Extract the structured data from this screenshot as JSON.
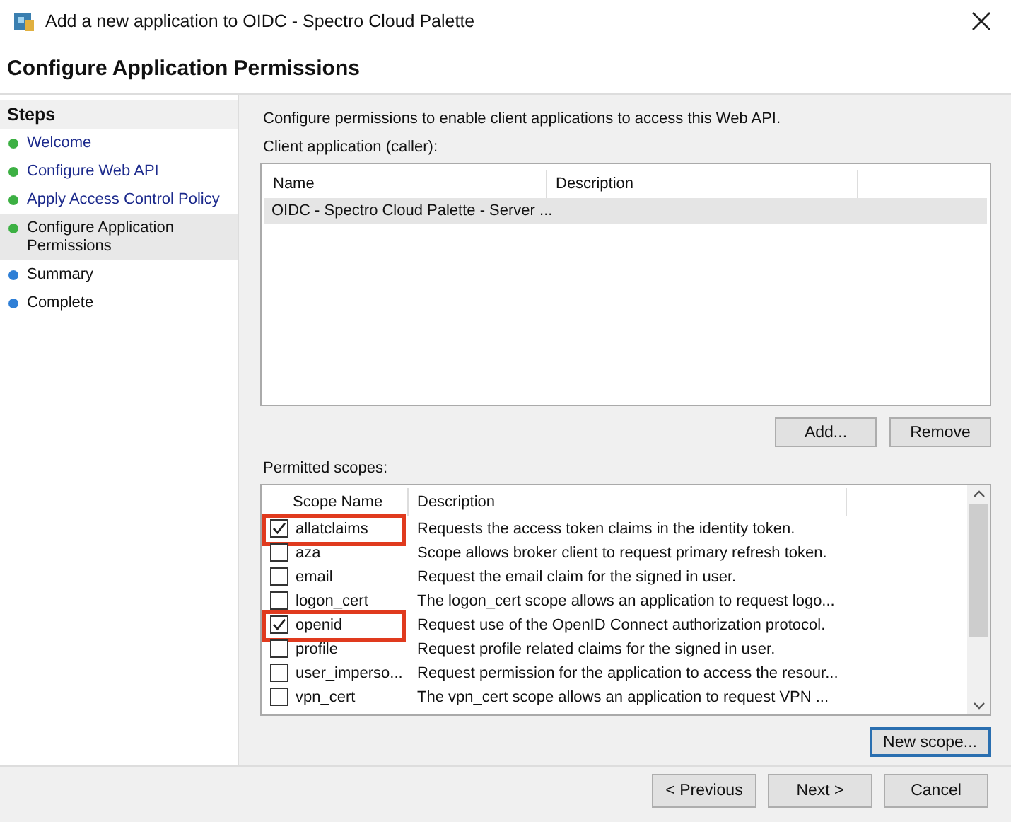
{
  "window": {
    "title": "Add a new application to OIDC - Spectro Cloud Palette"
  },
  "header": "Configure Application Permissions",
  "steps": {
    "title": "Steps",
    "items": [
      {
        "label": "Welcome",
        "kind": "link",
        "color": "#3cb043",
        "selected": false
      },
      {
        "label": "Configure Web API",
        "kind": "link",
        "color": "#3cb043",
        "selected": false
      },
      {
        "label": "Apply Access Control Policy",
        "kind": "link",
        "color": "#3cb043",
        "selected": false
      },
      {
        "label": "Configure Application Permissions",
        "kind": "text",
        "color": "#3cb043",
        "selected": true
      },
      {
        "label": "Summary",
        "kind": "text",
        "color": "#2f7fd6",
        "selected": false
      },
      {
        "label": "Complete",
        "kind": "text",
        "color": "#2f7fd6",
        "selected": false
      }
    ]
  },
  "intro": "Configure permissions to enable client applications to access this Web API.",
  "clients": {
    "label": "Client application (caller):",
    "columns": [
      "Name",
      "Description"
    ],
    "rows": [
      {
        "name": "OIDC - Spectro Cloud Palette - Server ...",
        "description": "",
        "selected": true
      }
    ],
    "buttons": [
      "Add...",
      "Remove"
    ]
  },
  "scopes": {
    "label": "Permitted scopes:",
    "columns": [
      "Scope Name",
      "Description"
    ],
    "rows": [
      {
        "name": "allatclaims",
        "description": "Requests the access token claims in the identity token.",
        "checked": true,
        "highlighted": true
      },
      {
        "name": "aza",
        "description": "Scope allows broker client to request primary refresh token.",
        "checked": false,
        "highlighted": false
      },
      {
        "name": "email",
        "description": "Request the email claim for the signed in user.",
        "checked": false,
        "highlighted": false
      },
      {
        "name": "logon_cert",
        "description": "The logon_cert scope allows an application to request logo...",
        "checked": false,
        "highlighted": false
      },
      {
        "name": "openid",
        "description": "Request use of the OpenID Connect authorization protocol.",
        "checked": true,
        "highlighted": true
      },
      {
        "name": "profile",
        "description": "Request profile related claims for the signed in user.",
        "checked": false,
        "highlighted": false
      },
      {
        "name": "user_imperso...",
        "description": "Request permission for the application to access the resour...",
        "checked": false,
        "highlighted": false
      },
      {
        "name": "vpn_cert",
        "description": "The vpn_cert scope allows an application to request VPN ...",
        "checked": false,
        "highlighted": false
      }
    ],
    "button": "New scope..."
  },
  "footer": {
    "buttons": [
      "< Previous",
      "Next >",
      "Cancel"
    ]
  }
}
